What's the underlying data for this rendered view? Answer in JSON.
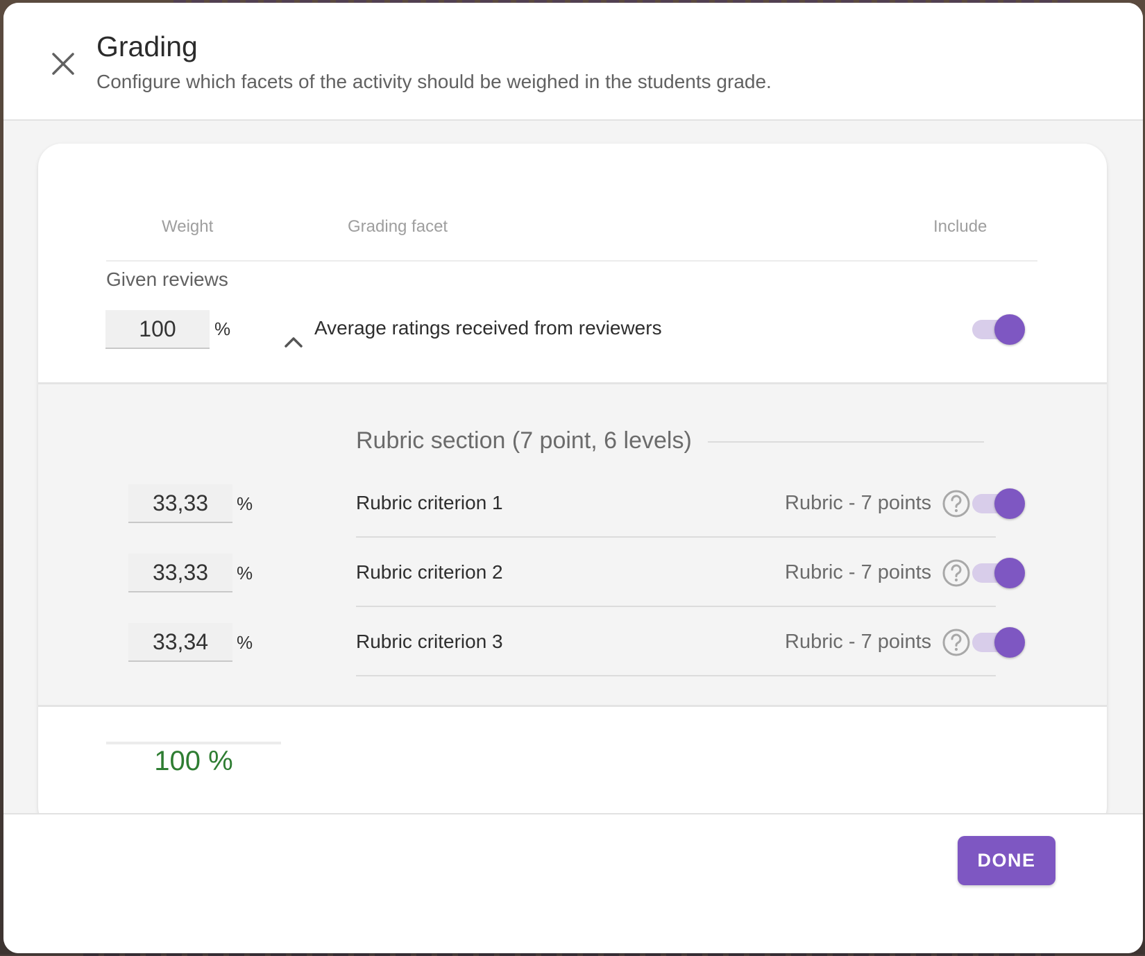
{
  "dialog": {
    "title": "Grading",
    "subtitle": "Configure which facets of the activity should be weighed in the students grade.",
    "done_label": "DONE"
  },
  "table": {
    "headers": {
      "weight": "Weight",
      "facet": "Grading facet",
      "include": "Include"
    }
  },
  "group": {
    "label": "Given reviews",
    "weight": "100",
    "unit": "%",
    "facet": "Average ratings received from reviewers",
    "included": true
  },
  "rubric": {
    "section_title": "Rubric section (7 point, 6 levels)",
    "criteria": [
      {
        "weight": "33,33",
        "unit": "%",
        "name": "Rubric criterion 1",
        "type": "Rubric - 7 points",
        "included": true
      },
      {
        "weight": "33,33",
        "unit": "%",
        "name": "Rubric criterion 2",
        "type": "Rubric - 7 points",
        "included": true
      },
      {
        "weight": "33,34",
        "unit": "%",
        "name": "Rubric criterion 3",
        "type": "Rubric - 7 points",
        "included": true
      }
    ]
  },
  "total": "100 %",
  "colors": {
    "accent": "#7e57c2",
    "toggle_track": "#d8cdea",
    "total_ok": "#2e7d32"
  },
  "icons": {
    "close": "close-icon",
    "collapse": "chevron-up-icon",
    "help": "help-circle-icon"
  }
}
